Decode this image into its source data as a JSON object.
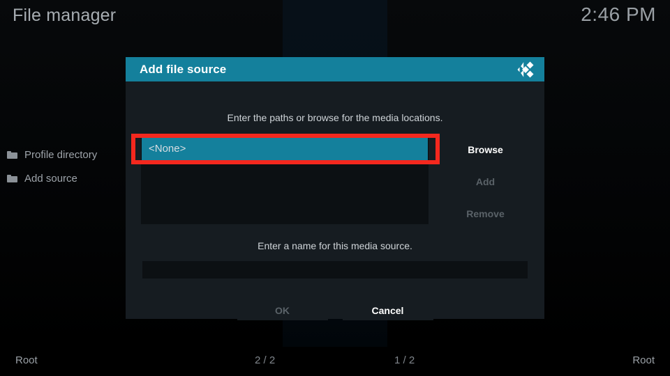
{
  "window": {
    "app_title": "File manager",
    "clock": "2:46 PM"
  },
  "background": {
    "file_list": [
      {
        "icon": "folder-icon",
        "label": "Profile directory"
      },
      {
        "icon": "folder-icon",
        "label": "Add source"
      }
    ],
    "statusbar": {
      "left_path": "Root",
      "left_count": "2 / 2",
      "right_count": "1 / 2",
      "right_path": "Root"
    }
  },
  "dialog": {
    "title": "Add file source",
    "logo_icon": "kodi-logo-icon",
    "hint_paths": "Enter the paths or browse for the media locations.",
    "path_items": [
      {
        "label": "<None>",
        "selected": true
      }
    ],
    "side_buttons": [
      {
        "label": "Browse",
        "disabled": false
      },
      {
        "label": "Add",
        "disabled": true
      },
      {
        "label": "Remove",
        "disabled": true
      }
    ],
    "hint_name": "Enter a name for this media source.",
    "name_input": {
      "value": "",
      "placeholder": ""
    },
    "footer_buttons": [
      {
        "label": "OK",
        "disabled": true
      },
      {
        "label": "Cancel",
        "disabled": false
      }
    ]
  },
  "annotation": {
    "highlight_color": "#f4281e",
    "target": "path-item-none"
  },
  "colors": {
    "accent_teal": "#14809c",
    "dialog_bg": "#161c21",
    "listbox_bg": "#0c1013",
    "text_primary": "#ffffff",
    "text_muted": "#9aa0a6",
    "text_disabled": "#5a6268"
  }
}
